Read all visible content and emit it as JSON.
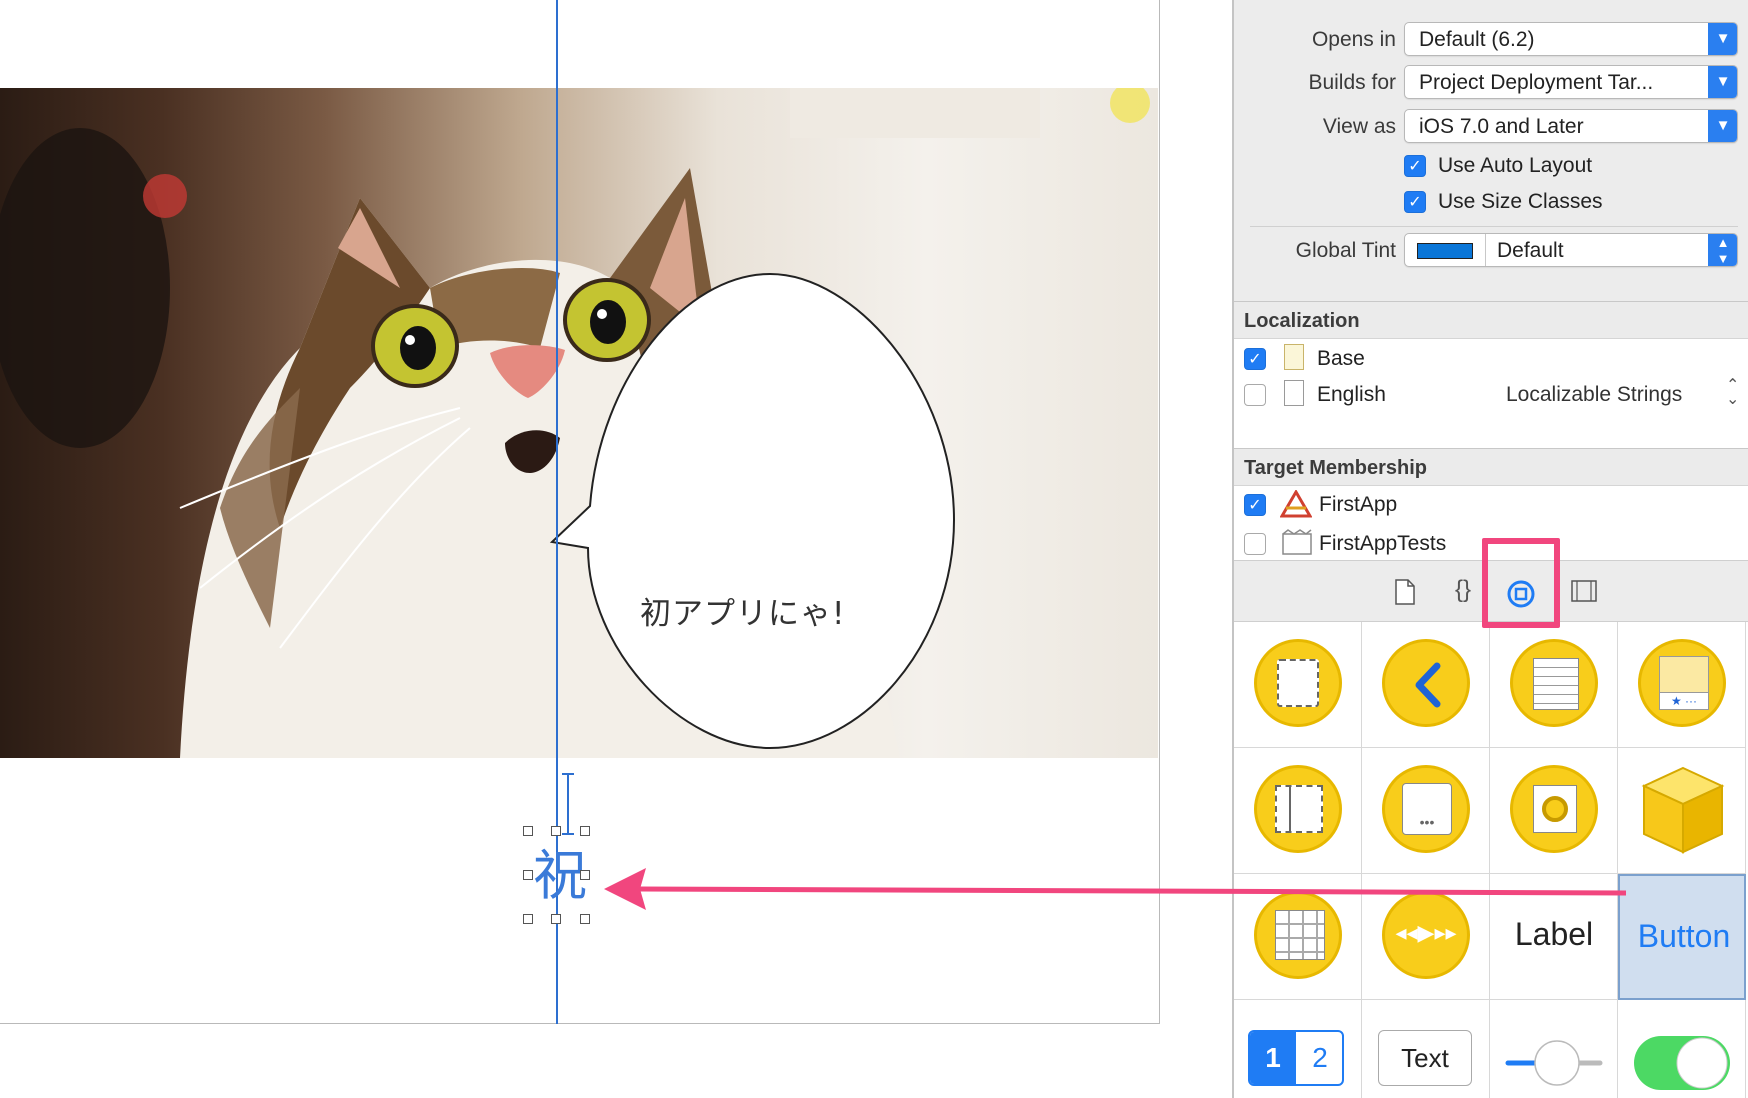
{
  "canvas": {
    "speech_bubble_text": "初アプリにゃ!",
    "selected_label_text": "祝"
  },
  "inspector": {
    "interface_builder_document": {
      "opens_in": {
        "label": "Opens in",
        "value": "Default (6.2)"
      },
      "builds_for": {
        "label": "Builds for",
        "value": "Project Deployment Tar..."
      },
      "view_as": {
        "label": "View as",
        "value": "iOS 7.0 and Later"
      },
      "use_auto_layout": {
        "label": "Use Auto Layout",
        "checked": true
      },
      "use_size_classes": {
        "label": "Use Size Classes",
        "checked": true
      },
      "global_tint": {
        "label": "Global Tint",
        "value": "Default",
        "color": "#0a76d8"
      }
    },
    "localization": {
      "title": "Localization",
      "items": [
        {
          "label": "Base",
          "checked": true,
          "type": ""
        },
        {
          "label": "English",
          "checked": false,
          "type": "Localizable Strings"
        }
      ]
    },
    "target_membership": {
      "title": "Target Membership",
      "items": [
        {
          "label": "FirstApp",
          "checked": true
        },
        {
          "label": "FirstAppTests",
          "checked": false
        }
      ]
    },
    "library": {
      "tabs": [
        "file-template-icon",
        "code-snippet-icon",
        "object-library-icon",
        "media-library-icon"
      ],
      "selected_tab": "object-library-icon",
      "objects": [
        {
          "name": "view-controller-icon"
        },
        {
          "name": "navigation-controller-icon"
        },
        {
          "name": "table-view-controller-icon"
        },
        {
          "name": "tab-bar-controller-icon"
        },
        {
          "name": "split-view-controller-icon"
        },
        {
          "name": "page-view-controller-icon"
        },
        {
          "name": "glkit-view-controller-icon"
        },
        {
          "name": "object-cube-icon"
        },
        {
          "name": "collection-view-controller-icon"
        },
        {
          "name": "av-player-view-controller-icon"
        },
        {
          "name": "label",
          "text": "Label"
        },
        {
          "name": "button",
          "text": "Button"
        },
        {
          "name": "segmented-control",
          "seg1": "1",
          "seg2": "2"
        },
        {
          "name": "text-field",
          "text": "Text"
        },
        {
          "name": "slider-icon"
        },
        {
          "name": "switch-icon"
        }
      ]
    }
  },
  "colors": {
    "accent_blue": "#1f7cf4",
    "highlight_pink": "#f1467e",
    "library_yellow": "#f8cd1b"
  }
}
